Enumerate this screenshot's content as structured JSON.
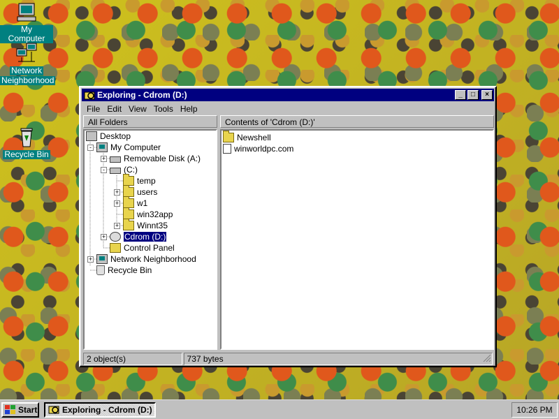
{
  "desktop": {
    "icons": [
      {
        "label": "My Computer",
        "icon": "my-computer-icon"
      },
      {
        "label": "Network Neighborhood",
        "label_line1": "Network",
        "label_line2": "Neighborhood",
        "icon": "network-icon"
      },
      {
        "label": "Recycle Bin",
        "icon": "recycle-bin-icon"
      }
    ]
  },
  "window": {
    "title": "Exploring - Cdrom (D:)",
    "menu": [
      "File",
      "Edit",
      "View",
      "Tools",
      "Help"
    ],
    "tree_header": "All Folders",
    "contents_header": "Contents of 'Cdrom (D:)'",
    "tree": [
      {
        "label": "Desktop",
        "icon": "desktop-icon",
        "expander": ""
      },
      {
        "label": "My Computer",
        "icon": "computer-icon",
        "expander": "-"
      },
      {
        "label": "Removable Disk (A:)",
        "icon": "floppy-drive-icon",
        "expander": "+"
      },
      {
        "label": "(C:)",
        "icon": "hard-drive-icon",
        "expander": "-"
      },
      {
        "label": "temp",
        "icon": "folder-icon",
        "expander": ""
      },
      {
        "label": "users",
        "icon": "folder-icon",
        "expander": "+"
      },
      {
        "label": "w1",
        "icon": "folder-icon",
        "expander": "+"
      },
      {
        "label": "win32app",
        "icon": "folder-icon",
        "expander": ""
      },
      {
        "label": "Winnt35",
        "icon": "folder-icon",
        "expander": "+"
      },
      {
        "label": "Cdrom (D:)",
        "icon": "cdrom-icon",
        "expander": "+",
        "selected": true
      },
      {
        "label": "Control Panel",
        "icon": "control-panel-icon",
        "expander": ""
      },
      {
        "label": "Network Neighborhood",
        "icon": "network-icon",
        "expander": "+"
      },
      {
        "label": "Recycle Bin",
        "icon": "recycle-bin-icon",
        "expander": ""
      }
    ],
    "contents": [
      {
        "label": "Newshell",
        "icon": "folder-icon"
      },
      {
        "label": "winworldpc.com",
        "icon": "document-icon"
      }
    ],
    "status": {
      "objects": "2 object(s)",
      "size": "737 bytes"
    }
  },
  "taskbar": {
    "start_label": "Start",
    "task_label": "Exploring - Cdrom (D:)",
    "clock": "10:26 PM"
  }
}
